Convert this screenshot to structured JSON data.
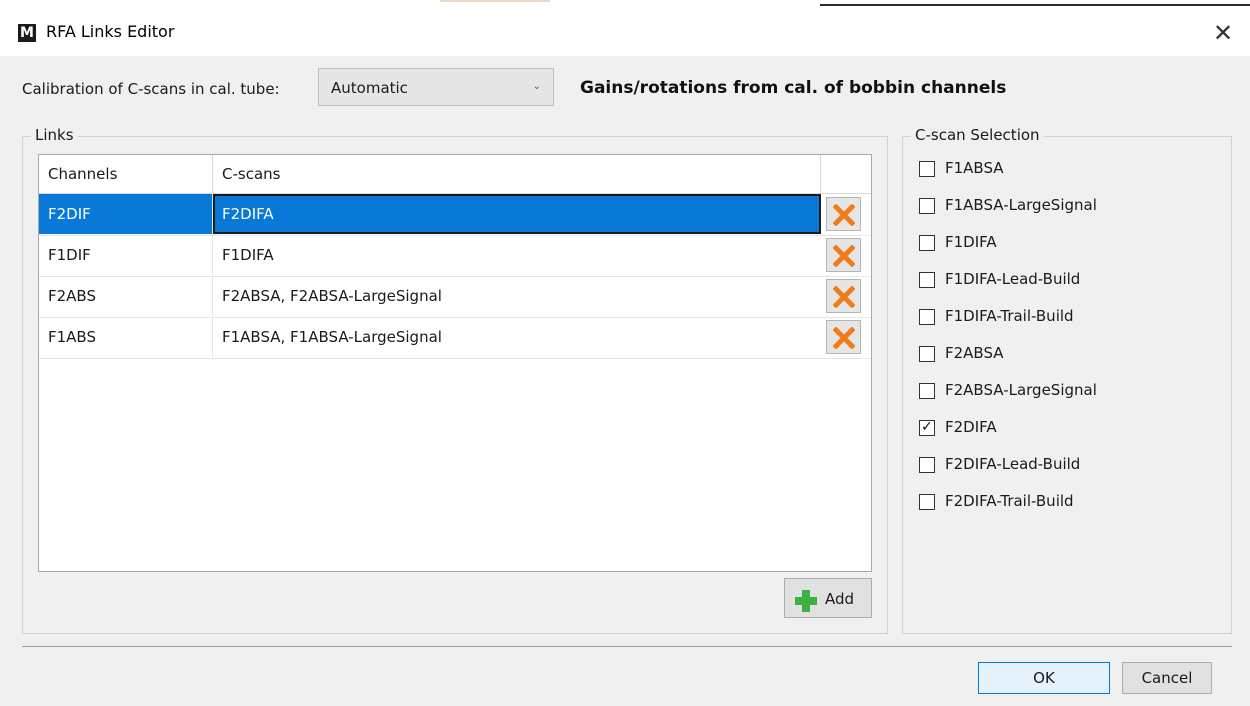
{
  "window": {
    "title": "RFA Links Editor",
    "app_icon_letter": "M",
    "close_symbol": "✕"
  },
  "calibration": {
    "label": "Calibration of C-scans in cal. tube:",
    "selected": "Automatic",
    "note": "Gains/rotations from cal. of bobbin channels"
  },
  "links": {
    "title": "Links",
    "columns": [
      "Channels",
      "C-scans"
    ],
    "rows": [
      {
        "channel": "F2DIF",
        "cscans": "F2DIFA",
        "selected": true
      },
      {
        "channel": "F1DIF",
        "cscans": "F1DIFA",
        "selected": false
      },
      {
        "channel": "F2ABS",
        "cscans": "F2ABSA, F2ABSA-LargeSignal",
        "selected": false
      },
      {
        "channel": "F1ABS",
        "cscans": "F1ABSA, F1ABSA-LargeSignal",
        "selected": false
      }
    ],
    "add_label": "Add"
  },
  "cscan_selection": {
    "title": "C-scan Selection",
    "items": [
      {
        "label": "F1ABSA",
        "checked": false
      },
      {
        "label": "F1ABSA-LargeSignal",
        "checked": false
      },
      {
        "label": "F1DIFA",
        "checked": false
      },
      {
        "label": "F1DIFA-Lead-Build",
        "checked": false
      },
      {
        "label": "F1DIFA-Trail-Build",
        "checked": false
      },
      {
        "label": "F2ABSA",
        "checked": false
      },
      {
        "label": "F2ABSA-LargeSignal",
        "checked": false
      },
      {
        "label": "F2DIFA",
        "checked": true
      },
      {
        "label": "F2DIFA-Lead-Build",
        "checked": false
      },
      {
        "label": "F2DIFA-Trail-Build",
        "checked": false
      }
    ]
  },
  "buttons": {
    "ok": "OK",
    "cancel": "Cancel"
  },
  "colors": {
    "selection": "#0a78d7",
    "delete_icon": "#f07d1a",
    "add_icon": "#3cb043"
  }
}
